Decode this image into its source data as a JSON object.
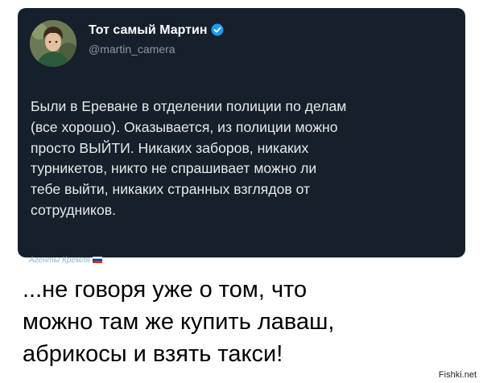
{
  "tweet": {
    "display_name": "Тот самый Мартин",
    "handle": "@martin_camera",
    "text_lines": [
      "Были в Ереване в отделении полиции по делам",
      "(все хорошо). Оказывается, из полиции можно",
      "просто ВЫЙТИ. Никаких заборов, никаких",
      "турникетов, никто не спрашивает можно ли",
      "тебе выйти, никаких странных взглядов от",
      "сотрудников."
    ]
  },
  "source_tag": "Агенты Кремля",
  "caption_lines": [
    "...не говоря уже о том, что",
    "можно там же купить лаваш,",
    "абрикосы и взять такси!"
  ],
  "watermark": "Fishki.net",
  "icons": {
    "verified": "verified-badge-icon",
    "flag": "russian-flag-icon"
  },
  "colors": {
    "card_background": "#15202b",
    "verified_badge": "#1d9bf0",
    "handle_text": "#8b98a5"
  }
}
